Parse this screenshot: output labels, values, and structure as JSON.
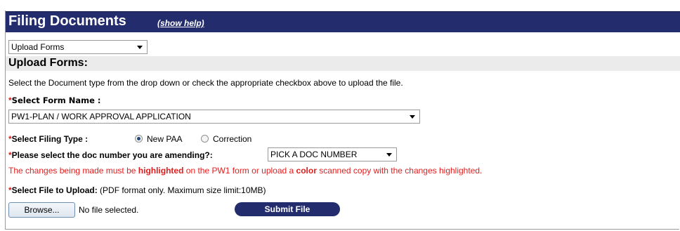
{
  "header": {
    "title": "Filing Documents",
    "help_link": "(show help)"
  },
  "upload_select": {
    "value": "Upload Forms"
  },
  "section": {
    "title": "Upload Forms:",
    "instructions": "Select the Document type from the drop down or check the appropriate checkbox above to upload the file."
  },
  "form_name": {
    "required_mark": "*",
    "label": "Select Form Name :",
    "value": "PW1-PLAN / WORK APPROVAL APPLICATION"
  },
  "filing_type": {
    "required_mark": "*",
    "label": "Select Filing Type :",
    "options": [
      {
        "label": "New PAA",
        "selected": true
      },
      {
        "label": "Correction",
        "selected": false
      }
    ]
  },
  "doc_number": {
    "required_mark": "*",
    "label": "Please select the doc number you are amending?:",
    "value": "PICK A DOC NUMBER"
  },
  "warning": {
    "part1": "The changes being made must be ",
    "bold1": "highlighted",
    "part2": " on the PW1 form or upload a ",
    "bold2": "color",
    "part3": " scanned copy with the changes highlighted."
  },
  "file_upload": {
    "required_mark": "*",
    "label": "Select File to Upload:",
    "note": " (PDF format only. Maximum size limit:10MB)",
    "browse_label": "Browse...",
    "status": "No file selected.",
    "submit_label": "Submit File"
  },
  "colors": {
    "header_bg": "#232d6e",
    "required": "#e21d1d",
    "section_bg": "#ebebeb"
  }
}
